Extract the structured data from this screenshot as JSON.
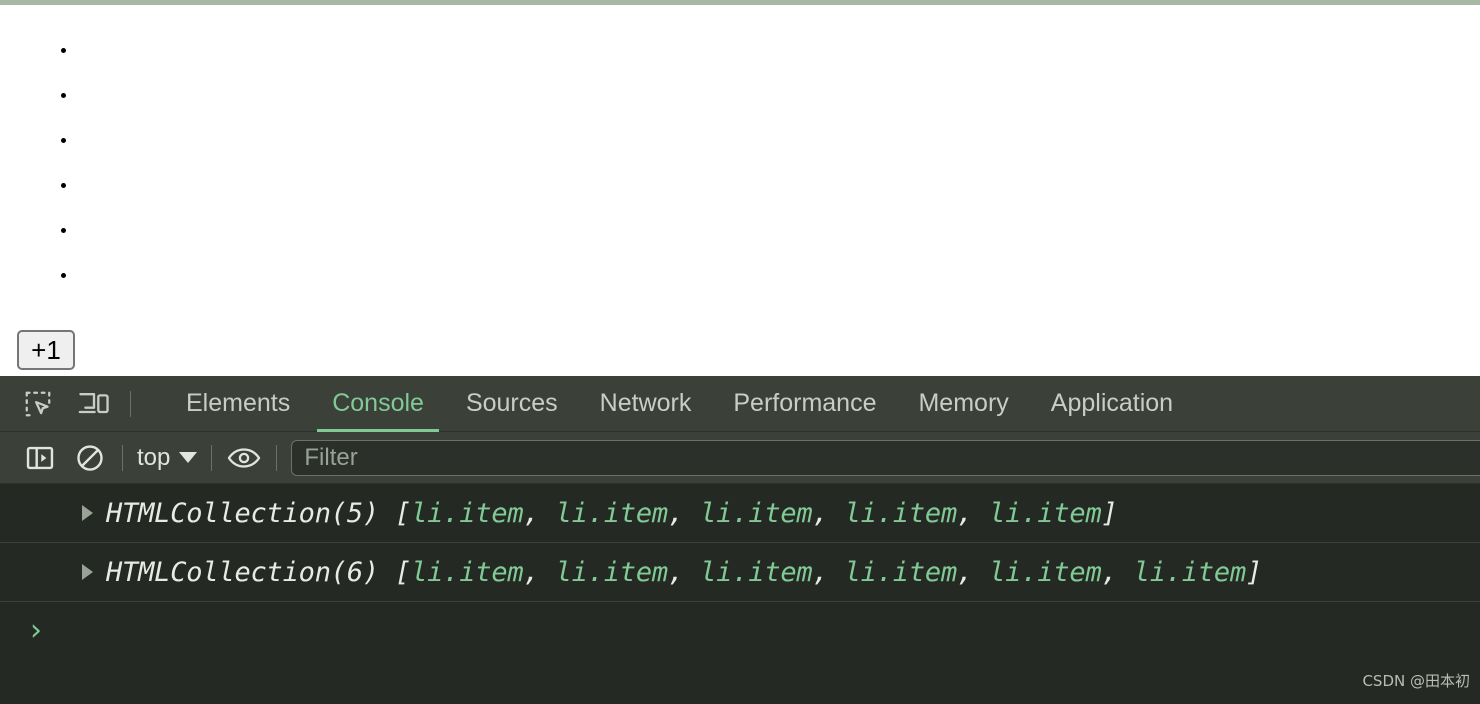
{
  "page": {
    "list_items": [
      "",
      "",
      "",
      "",
      "",
      ""
    ],
    "button_label": "+1"
  },
  "devtools": {
    "icons": {
      "inspect": "inspect-element-icon",
      "device": "device-toolbar-icon",
      "sidebar": "console-sidebar-icon",
      "clear": "clear-console-icon",
      "eye": "eye-icon"
    },
    "tabs": [
      {
        "label": "Elements",
        "active": false
      },
      {
        "label": "Console",
        "active": true
      },
      {
        "label": "Sources",
        "active": false
      },
      {
        "label": "Network",
        "active": false
      },
      {
        "label": "Performance",
        "active": false
      },
      {
        "label": "Memory",
        "active": false
      },
      {
        "label": "Application",
        "active": false
      }
    ],
    "toolbar": {
      "context": "top",
      "filter_placeholder": "Filter",
      "filter_value": ""
    },
    "console_rows": [
      {
        "prefix": "HTMLCollection(5) [",
        "items": [
          "li.item",
          "li.item",
          "li.item",
          "li.item",
          "li.item"
        ],
        "suffix": "]"
      },
      {
        "prefix": "HTMLCollection(6) [",
        "items": [
          "li.item",
          "li.item",
          "li.item",
          "li.item",
          "li.item",
          "li.item"
        ],
        "suffix": "]"
      }
    ],
    "prompt": "›",
    "watermark": "CSDN @田本初"
  },
  "colors": {
    "accent_green": "#81c995",
    "tabbar_bg": "#3b4039",
    "console_bg": "#242924",
    "page_top_bar": "#a7b9a4"
  }
}
